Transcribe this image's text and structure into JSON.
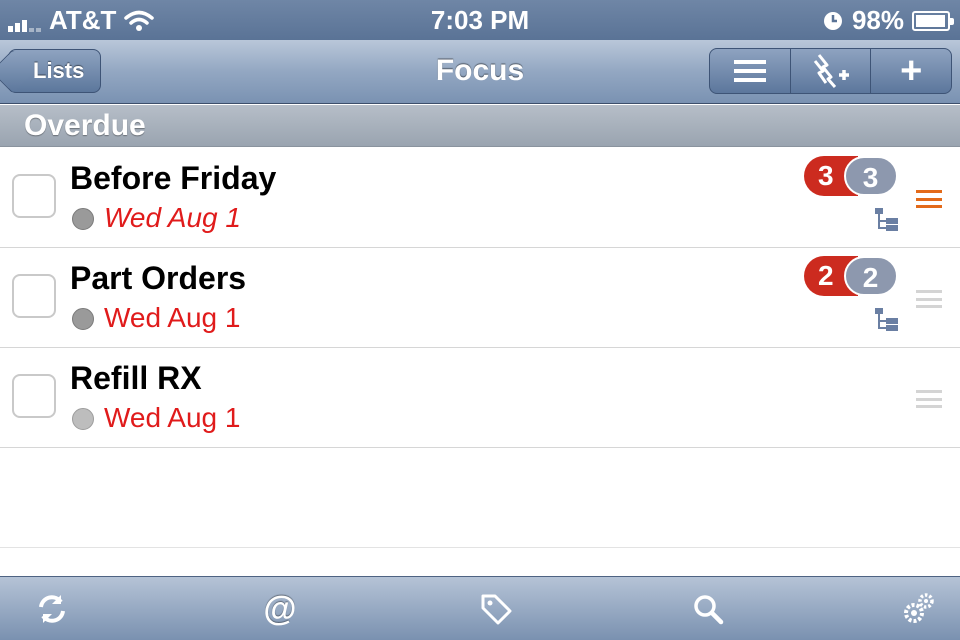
{
  "status_bar": {
    "carrier": "AT&T",
    "time": "7:03 PM",
    "battery_text": "98%",
    "battery_level": 0.98
  },
  "nav": {
    "back_label": "Lists",
    "title": "Focus"
  },
  "section": {
    "title": "Overdue"
  },
  "tasks": [
    {
      "title": "Before Friday",
      "date": "Wed Aug 1",
      "badge_red": "3",
      "badge_gray": "3",
      "has_subtasks": true
    },
    {
      "title": "Part Orders",
      "date": "Wed Aug 1",
      "badge_red": "2",
      "badge_gray": "2",
      "has_subtasks": true
    },
    {
      "title": "Refill RX",
      "date": "Wed Aug 1",
      "has_subtasks": false
    }
  ],
  "toolbar": {
    "icons": [
      "sync-icon",
      "at-icon",
      "tag-icon",
      "search-icon",
      "settings-gear-icon"
    ],
    "at_glyph": "@"
  },
  "colors": {
    "overdue_red": "#e01b1b",
    "badge_red": "#cc2b1f",
    "badge_gray": "#8d98ae",
    "active_grip": "#e36a1a",
    "nav_blue": "#7a92b2"
  }
}
